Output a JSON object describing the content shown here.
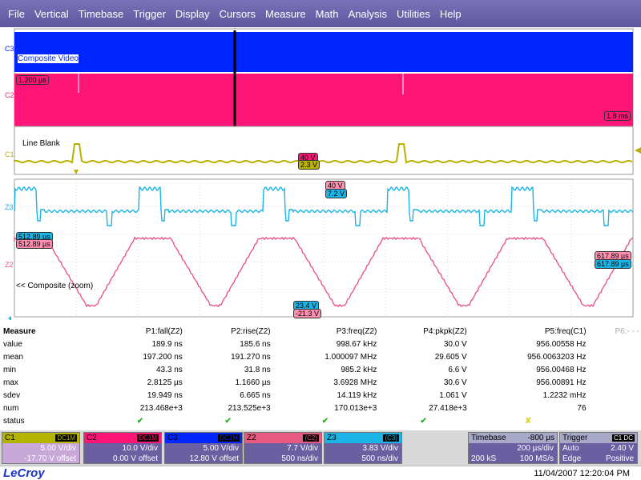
{
  "menu": [
    "File",
    "Vertical",
    "Timebase",
    "Trigger",
    "Display",
    "Cursors",
    "Measure",
    "Math",
    "Analysis",
    "Utilities",
    "Help"
  ],
  "traces": {
    "c3": {
      "label": "C3",
      "annotation": "Composite Video",
      "color": "#0026ff"
    },
    "c2": {
      "label": "C2",
      "zoom_tag": "1.200 µs",
      "color": "#ff1478"
    },
    "c2_right_tag": "1.8 ms",
    "c1": {
      "label": "C1",
      "annotation": "Line Blank",
      "color": "#b9b000"
    },
    "cursor_tags": {
      "c1_level": "2.3 V",
      "c2_level": "40 V"
    },
    "z3": {
      "label": "Z3",
      "top_tag": "7.2 V",
      "top_tag2": "40 V",
      "left_tag": "512.89 µs",
      "right_tag": "617.89 µs",
      "color": "#1ab4e6"
    },
    "z2": {
      "label": "Z2",
      "left_tag": "512.89 µs",
      "right_tag": "617.89 µs",
      "annotation": "<< Composite (zoom)",
      "bottom_tag": "23.4 V",
      "bottom_tag2": "-21.3 V",
      "color": "#e65a82"
    }
  },
  "measure": {
    "title": "Measure",
    "columns": [
      "P1:fall(Z2)",
      "P2:rise(Z2)",
      "P3:freq(Z2)",
      "P4:pkpk(Z2)",
      "P5:freq(C1)",
      "P6:- - -"
    ],
    "rows": [
      {
        "label": "value",
        "cells": [
          "189.9 ns",
          "185.6 ns",
          "998.67 kHz",
          "30.0 V",
          "956.00558 Hz",
          ""
        ]
      },
      {
        "label": "mean",
        "cells": [
          "197.200 ns",
          "191.270 ns",
          "1.000097 MHz",
          "29.605 V",
          "956.0063203 Hz",
          ""
        ]
      },
      {
        "label": "min",
        "cells": [
          "43.3 ns",
          "31.8 ns",
          "985.2 kHz",
          "6.6 V",
          "956.00468 Hz",
          ""
        ]
      },
      {
        "label": "max",
        "cells": [
          "2.8125 µs",
          "1.1660 µs",
          "3.6928 MHz",
          "30.6 V",
          "956.00891 Hz",
          ""
        ]
      },
      {
        "label": "sdev",
        "cells": [
          "19.949 ns",
          "6.665 ns",
          "14.119 kHz",
          "1.061 V",
          "1.2232 mHz",
          ""
        ]
      },
      {
        "label": "num",
        "cells": [
          "213.468e+3",
          "213.525e+3",
          "170.013e+3",
          "27.418e+3",
          "76",
          ""
        ]
      },
      {
        "label": "status",
        "cells": [
          "✔",
          "✔",
          "✔",
          "✔",
          "✘",
          ""
        ]
      }
    ]
  },
  "channels": [
    {
      "name": "C1",
      "coupling": "DC1M",
      "l1": "5.00 V/div",
      "l2": "-17.70 V offset",
      "bg": "#c8a8d8",
      "hd": "#b4b400"
    },
    {
      "name": "C2",
      "coupling": "DC1M",
      "l1": "10.0 V/div",
      "l2": "0.00 V offset",
      "bg": "#6a5fa0",
      "hd": "#ff1478"
    },
    {
      "name": "C3",
      "coupling": "DC1M",
      "l1": "5.00 V/div",
      "l2": "12.80 V offset",
      "bg": "#6a5fa0",
      "hd": "#0026ff"
    },
    {
      "name": "Z2",
      "coupling": "(C2)",
      "l1": "7.7 V/div",
      "l2": "500 ns/div",
      "bg": "#6a5fa0",
      "hd": "#e65a82"
    },
    {
      "name": "Z3",
      "coupling": "(C3)",
      "l1": "3.83 V/div",
      "l2": "500 ns/div",
      "bg": "#6a5fa0",
      "hd": "#1ab4e6"
    }
  ],
  "timebase": {
    "title": "Timebase",
    "pos": "-800 µs",
    "l1a": "",
    "l1b": "200 µs/div",
    "l2a": "200 kS",
    "l2b": "100 MS/s"
  },
  "trigger": {
    "title": "Trigger",
    "cp": "C1 DC",
    "l1a": "Auto",
    "l1b": "2.40 V",
    "l2a": "Edge",
    "l2b": "Positive"
  },
  "status": {
    "logo": "LeCroy",
    "timestamp": "11/04/2007 12:20:04 PM"
  }
}
